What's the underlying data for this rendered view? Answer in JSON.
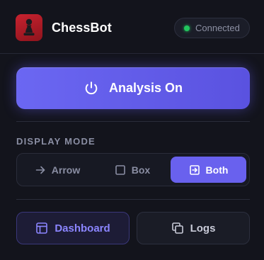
{
  "header": {
    "brand": "ChessBot",
    "status": {
      "label": "Connected",
      "color": "#22c55e"
    }
  },
  "analysis": {
    "label": "Analysis On",
    "state": "on"
  },
  "display_mode": {
    "title": "DISPLAY MODE",
    "options": [
      {
        "label": "Arrow",
        "icon": "arrow-right-icon"
      },
      {
        "label": "Box",
        "icon": "square-icon"
      },
      {
        "label": "Both",
        "icon": "box-arrow-icon"
      }
    ],
    "selected": "Both"
  },
  "actions": {
    "dashboard": {
      "label": "Dashboard",
      "icon": "layout-icon"
    },
    "logs": {
      "label": "Logs",
      "icon": "copy-icon"
    }
  },
  "colors": {
    "accent": "#6961ee",
    "background": "#13141c",
    "logo": "#c8222f"
  }
}
